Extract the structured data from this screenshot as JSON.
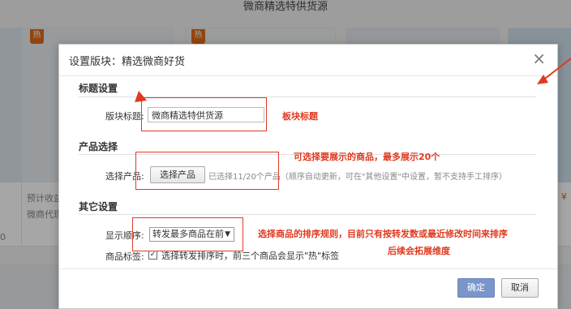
{
  "background": {
    "page_title": "微商精选特供货源",
    "hot_badge": "热",
    "card_text_1": "预计收益",
    "card_text_2": "微商代理",
    "price_fragment": "¥",
    "side_digit": "0"
  },
  "dialog": {
    "title": "设置版块：精选微商好货",
    "close_glyph": "×",
    "section_title": {
      "title": "标题设置",
      "label": "版块标题:",
      "value": "微商精选特供货源"
    },
    "section_product": {
      "title": "产品选择",
      "label": "选择产品:",
      "button": "选择产品",
      "hint": "已选择11/20个产品（顺序自动更新，可在\"其他设置\"中设置，暂不支持手工排序）"
    },
    "section_other": {
      "title": "其它设置",
      "order_label": "显示顺序:",
      "order_value": "转发最多商品在前",
      "order_caret": "▼",
      "tag_label": "商品标签:",
      "tag_checked_glyph": "✓",
      "tag_text": "选择转发排序时，前三个商品会显示\"热\"标签"
    },
    "confirm": "确定",
    "cancel": "取消"
  },
  "annotations": {
    "title_note": "板块标题",
    "product_note": "可选择要展示的商品，最多展示20个",
    "order_note": "选择商品的排序规则，目前只有按转发数或最近修改时间来排序",
    "order_note_2": "后续会拓展维度"
  },
  "colors": {
    "annotation_red": "#e0391f",
    "confirm_blue": "#7a95c9",
    "hot_orange": "#e06a1a"
  }
}
